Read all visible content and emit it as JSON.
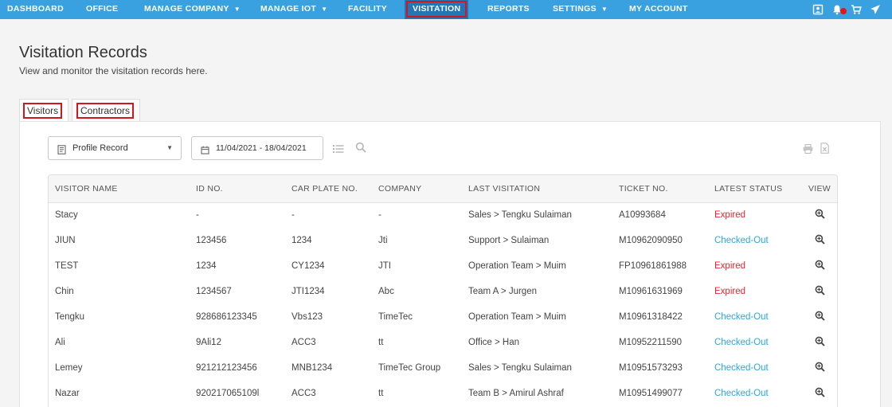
{
  "nav": {
    "items": [
      {
        "label": "DASHBOARD",
        "dropdown": false
      },
      {
        "label": "OFFICE",
        "dropdown": false
      },
      {
        "label": "MANAGE COMPANY",
        "dropdown": true
      },
      {
        "label": "MANAGE IOT",
        "dropdown": true
      },
      {
        "label": "FACILITY",
        "dropdown": false
      },
      {
        "label": "VISITATION",
        "dropdown": false,
        "active": true
      },
      {
        "label": "REPORTS",
        "dropdown": false
      },
      {
        "label": "SETTINGS",
        "dropdown": true
      },
      {
        "label": "MY ACCOUNT",
        "dropdown": false
      }
    ],
    "icons": [
      "id-card-icon",
      "bell-icon",
      "cart-icon",
      "rocket-icon"
    ],
    "background": "#3aa1e0"
  },
  "header": {
    "title": "Visitation Records",
    "subtitle": "View and monitor the visitation records here."
  },
  "tabs": [
    {
      "label": "Visitors",
      "active": true
    },
    {
      "label": "Contractors",
      "active": false
    }
  ],
  "toolbar": {
    "record_select": "Profile Record",
    "date_range": "11/04/2021 - 18/04/2021"
  },
  "table": {
    "columns": [
      "VISITOR NAME",
      "ID NO.",
      "CAR PLATE NO.",
      "COMPANY",
      "LAST VISITATION",
      "TICKET NO.",
      "LATEST STATUS",
      "VIEW"
    ],
    "rows": [
      {
        "name": "Stacy",
        "id_no": "-",
        "car_plate": "-",
        "company": "-",
        "last_visitation": "Sales > Tengku Sulaiman",
        "ticket": "A10993684",
        "status": "Expired"
      },
      {
        "name": "JIUN",
        "id_no": "123456",
        "car_plate": "1234",
        "company": "Jti",
        "last_visitation": "Support > Sulaiman",
        "ticket": "M10962090950",
        "status": "Checked-Out"
      },
      {
        "name": "TEST",
        "id_no": "1234",
        "car_plate": "CY1234",
        "company": "JTI",
        "last_visitation": "Operation Team > Muim",
        "ticket": "FP10961861988",
        "status": "Expired"
      },
      {
        "name": "Chin",
        "id_no": "1234567",
        "car_plate": "JTI1234",
        "company": "Abc",
        "last_visitation": "Team A > Jurgen",
        "ticket": "M10961631969",
        "status": "Expired"
      },
      {
        "name": "Tengku",
        "id_no": "928686123345",
        "car_plate": "Vbs123",
        "company": "TimeTec",
        "last_visitation": "Operation Team > Muim",
        "ticket": "M10961318422",
        "status": "Checked-Out"
      },
      {
        "name": "Ali",
        "id_no": "9Ali12",
        "car_plate": "ACC3",
        "company": "tt",
        "last_visitation": "Office > Han",
        "ticket": "M10952211590",
        "status": "Checked-Out"
      },
      {
        "name": "Lemey",
        "id_no": "921212123456",
        "car_plate": "MNB1234",
        "company": "TimeTec Group",
        "last_visitation": "Sales > Tengku Sulaiman",
        "ticket": "M10951573293",
        "status": "Checked-Out"
      },
      {
        "name": "Nazar",
        "id_no": "920217065109l",
        "car_plate": "ACC3",
        "company": "tt",
        "last_visitation": "Team B > Amirul Ashraf",
        "ticket": "M10951499077",
        "status": "Checked-Out"
      }
    ]
  },
  "colors": {
    "expired": "#e5262c",
    "checked_out": "#29a8e0",
    "highlight_box": "#d0161e"
  }
}
